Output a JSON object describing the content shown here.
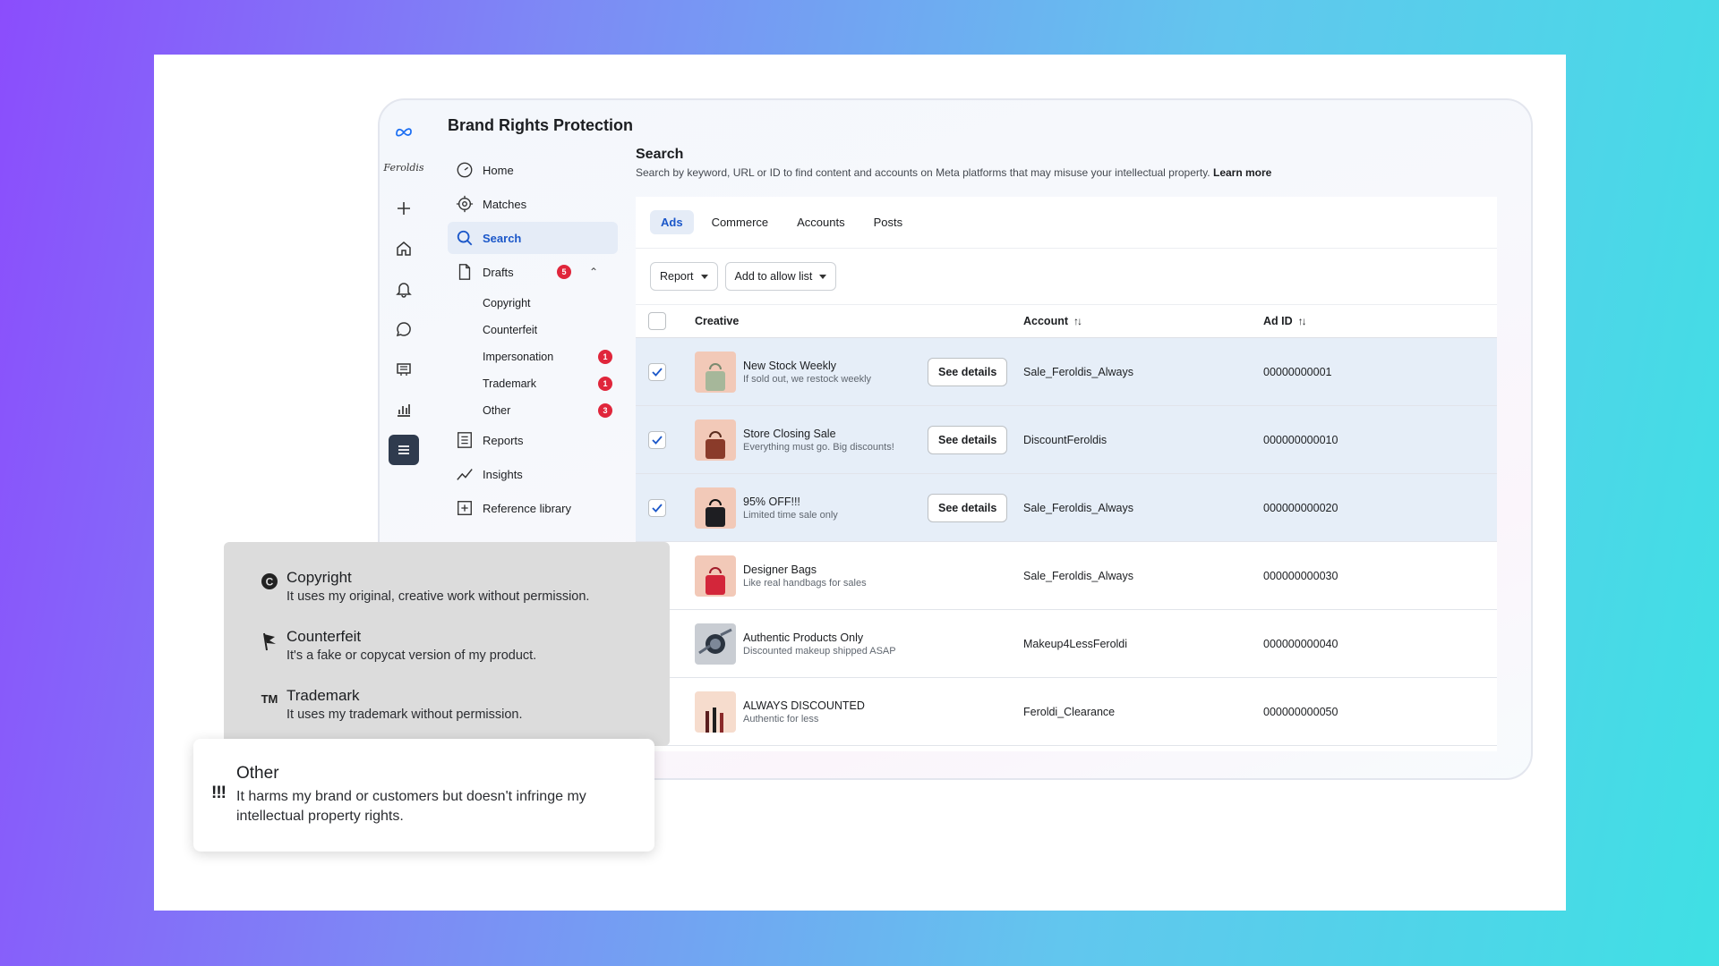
{
  "app": {
    "title": "Brand Rights Protection",
    "brand_script": "Feroldis"
  },
  "rail": {
    "icons": [
      "meta-logo-icon",
      "plus-icon",
      "home-icon",
      "bell-icon",
      "chat-icon",
      "billboard-icon",
      "bar-chart-icon",
      "menu-icon"
    ]
  },
  "nav": {
    "home": "Home",
    "matches": "Matches",
    "search": "Search",
    "drafts": "Drafts",
    "drafts_count": "5",
    "sub": [
      {
        "label": "Copyright",
        "count": ""
      },
      {
        "label": "Counterfeit",
        "count": ""
      },
      {
        "label": "Impersonation",
        "count": "1"
      },
      {
        "label": "Trademark",
        "count": "1"
      },
      {
        "label": "Other",
        "count": "3"
      }
    ],
    "reports": "Reports",
    "insights": "Insights",
    "reference_library": "Reference library"
  },
  "search": {
    "title": "Search",
    "description": "Search by keyword, URL or ID to find content and accounts on Meta platforms that may misuse your intellectual property.",
    "learn_more": "Learn more"
  },
  "tabs": [
    "Ads",
    "Commerce",
    "Accounts",
    "Posts"
  ],
  "toolbar": {
    "report": "Report",
    "allow_list": "Add to allow list"
  },
  "table": {
    "headers": {
      "creative": "Creative",
      "account": "Account",
      "ad_id": "Ad ID"
    },
    "see_details": "See details",
    "rows": [
      {
        "title": "New Stock Weekly",
        "subtitle": "If sold out, we restock weekly",
        "account": "Sale_Feroldis_Always",
        "ad_id": "00000000001",
        "checked": true
      },
      {
        "title": "Store Closing Sale",
        "subtitle": "Everything must go. Big discounts!",
        "account": "DiscountFeroldis",
        "ad_id": "000000000010",
        "checked": true
      },
      {
        "title": "95% OFF!!!",
        "subtitle": "Limited time sale only",
        "account": "Sale_Feroldis_Always",
        "ad_id": "000000000020",
        "checked": true
      },
      {
        "title": "Designer Bags",
        "subtitle": "Like real handbags for sales",
        "account": "Sale_Feroldis_Always",
        "ad_id": "000000000030",
        "checked": false
      },
      {
        "title": "Authentic Products Only",
        "subtitle": "Discounted makeup shipped ASAP",
        "account": "Makeup4LessFeroldi",
        "ad_id": "000000000040",
        "checked": false
      },
      {
        "title": "ALWAYS DISCOUNTED",
        "subtitle": "Authentic for less",
        "account": "Feroldi_Clearance",
        "ad_id": "000000000050",
        "checked": false
      }
    ]
  },
  "overlay": {
    "copyright": {
      "icon": "C",
      "title": "Copyright",
      "desc": "It uses my original, creative work without permission."
    },
    "counterfeit": {
      "icon": "flag-icon",
      "title": "Counterfeit",
      "desc": "It's a fake or copycat version of my product."
    },
    "trademark": {
      "icon": "TM",
      "title": "Trademark",
      "desc": "It uses my trademark without permission."
    },
    "other": {
      "icon": "!!!",
      "title": "Other",
      "desc": "It harms my brand or customers but doesn't infringe my intellectual property rights."
    }
  },
  "colors": {
    "accent": "#1b57c9",
    "badge": "#e0263b",
    "selected_row": "#e6eef8"
  }
}
